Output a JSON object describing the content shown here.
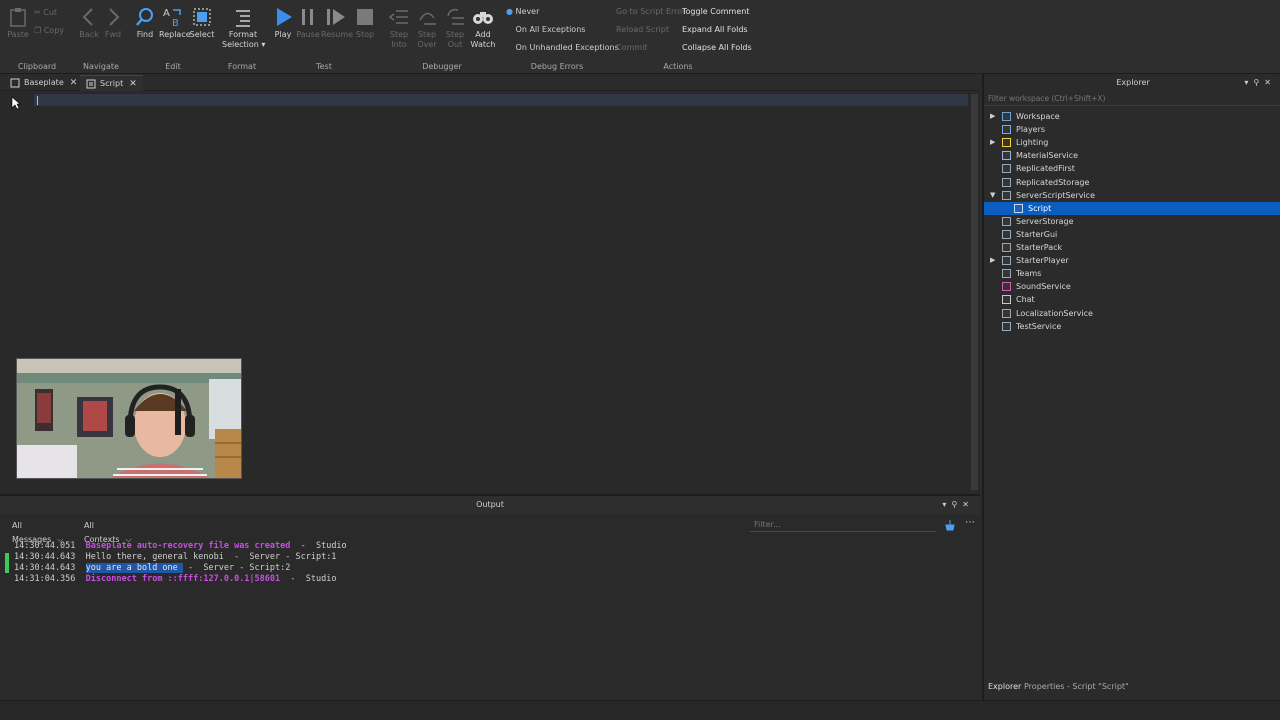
{
  "ribbon": {
    "clipboard": {
      "label": "Clipboard",
      "paste": "Paste",
      "cut": "Cut",
      "copy": "Copy"
    },
    "navigate": {
      "label": "Navigate",
      "back": "Back",
      "fwd": "Fwd"
    },
    "edit": {
      "label": "Edit",
      "find": "Find",
      "replace": "Replace",
      "select": "Select"
    },
    "format": {
      "label": "Format",
      "format_selection_1": "Format",
      "format_selection_2": "Selection"
    },
    "test": {
      "label": "Test",
      "play": "Play",
      "pause": "Pause",
      "resume": "Resume",
      "stop": "Stop"
    },
    "debugger": {
      "label": "Debugger",
      "step_into_1": "Step",
      "step_into_2": "Into",
      "step_over_1": "Step",
      "step_over_2": "Over",
      "step_out_1": "Step",
      "step_out_2": "Out",
      "add_watch_1": "Add",
      "add_watch_2": "Watch"
    },
    "debug_errors": {
      "label": "Debug Errors",
      "never": "Never",
      "all": "On All Exceptions",
      "unhandled": "On Unhandled Exceptions"
    },
    "actions": {
      "label": "Actions",
      "go_to_error": "Go to Script Error",
      "reload": "Reload Script",
      "commit": "Commit",
      "toggle_comment": "Toggle Comment",
      "expand": "Expand All Folds",
      "collapse": "Collapse All Folds"
    }
  },
  "tabs": [
    {
      "label": "Baseplate"
    },
    {
      "label": "Script"
    }
  ],
  "output": {
    "title": "Output",
    "messages_filter": "All Messages",
    "contexts_filter": "All Contexts",
    "filter_placeholder": "Filter...",
    "lines": [
      {
        "time": "14:30:44.051",
        "text": "Baseplate auto-recovery file was created",
        "source": "  -  Studio",
        "style": "purple"
      },
      {
        "time": "14:30:44.643",
        "text": "Hello there, general kenobi",
        "source": "  -  Server - Script:1",
        "style": "normal"
      },
      {
        "time": "14:30:44.643",
        "text": "you are a bold one ",
        "source": " -  Server - Script:2",
        "style": "sel"
      },
      {
        "time": "14:31:04.356",
        "text": "Disconnect from ::ffff:127.0.0.1|58601",
        "source": "  -  Studio",
        "style": "purple"
      }
    ]
  },
  "explorer": {
    "title": "Explorer",
    "filter_placeholder": "Filter workspace (Ctrl+Shift+X)",
    "items": [
      {
        "label": "Workspace",
        "arrow": "▶",
        "icon_color": "#6ea0d8"
      },
      {
        "label": "Players",
        "arrow": "",
        "icon_color": "#7fa8d8"
      },
      {
        "label": "Lighting",
        "arrow": "▶",
        "icon_color": "#f2d23c"
      },
      {
        "label": "MaterialService",
        "arrow": "",
        "icon_color": "#9bb4d0"
      },
      {
        "label": "ReplicatedFirst",
        "arrow": "",
        "icon_color": "#9aa8b8"
      },
      {
        "label": "ReplicatedStorage",
        "arrow": "",
        "icon_color": "#9aa8b8"
      },
      {
        "label": "ServerScriptService",
        "arrow": "▼",
        "icon_color": "#9aa8b8"
      },
      {
        "label": "Script",
        "arrow": "",
        "icon_color": "#c9d4e4"
      },
      {
        "label": "ServerStorage",
        "arrow": "",
        "icon_color": "#9aa8b8"
      },
      {
        "label": "StarterGui",
        "arrow": "",
        "icon_color": "#9aa8b8"
      },
      {
        "label": "StarterPack",
        "arrow": "",
        "icon_color": "#9aa8b8"
      },
      {
        "label": "StarterPlayer",
        "arrow": "▶",
        "icon_color": "#9aa8b8"
      },
      {
        "label": "Teams",
        "arrow": "",
        "icon_color": "#9aa8b8"
      },
      {
        "label": "SoundService",
        "arrow": "",
        "icon_color": "#d062b0"
      },
      {
        "label": "Chat",
        "arrow": "",
        "icon_color": "#c8c8c8"
      },
      {
        "label": "LocalizationService",
        "arrow": "",
        "icon_color": "#9aa8b8"
      },
      {
        "label": "TestService",
        "arrow": "",
        "icon_color": "#9aa8b8"
      }
    ],
    "bottom_tab_1": "Explorer",
    "bottom_tab_2": "Properties - Script \"Script\""
  }
}
